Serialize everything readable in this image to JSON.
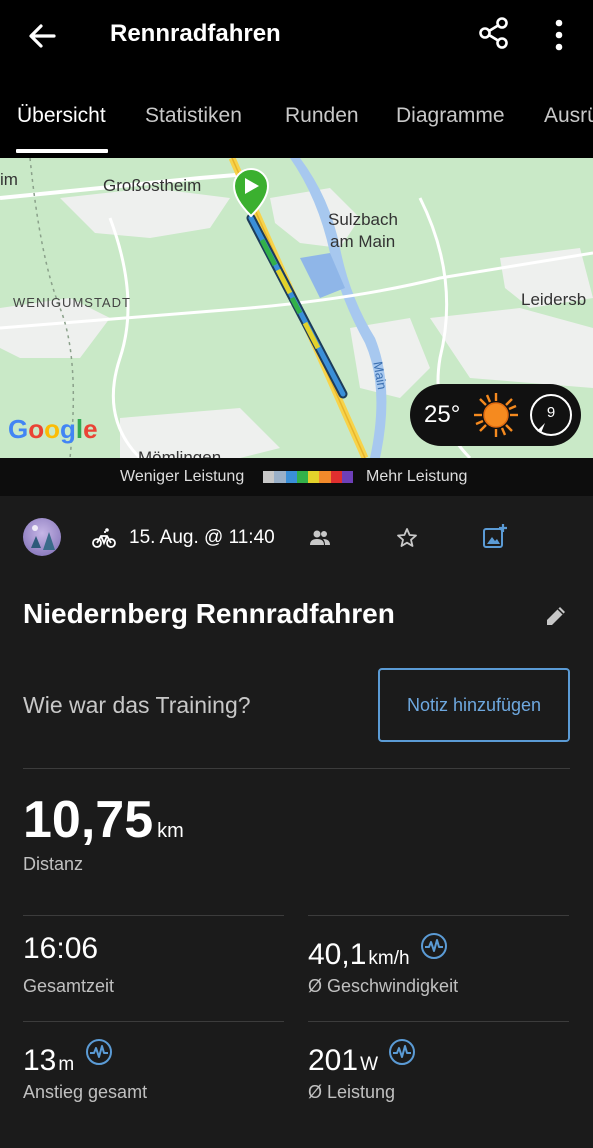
{
  "header": {
    "title": "Rennradfahren"
  },
  "tabs": [
    {
      "label": "Übersicht"
    },
    {
      "label": "Statistiken"
    },
    {
      "label": "Runden"
    },
    {
      "label": "Diagramme"
    },
    {
      "label": "Ausrü"
    }
  ],
  "map": {
    "labels": {
      "im": "im",
      "grossostheim": "Großostheim",
      "sulzbach_1": "Sulzbach",
      "sulzbach_2": "am Main",
      "wenigumstadt": "WENIGUMSTADT",
      "leidersb": "Leidersb",
      "main": "Main",
      "mömlingen": "Mömlingen"
    },
    "provider": "Google",
    "weather": {
      "temperature": "25°",
      "icon": "sun-icon",
      "wind": "9"
    }
  },
  "legend": {
    "less": "Weniger Leistung",
    "more": "Mehr Leistung",
    "colors": [
      "#c8c8c8",
      "#9ab0c8",
      "#3a8fd8",
      "#33b14a",
      "#e3d22b",
      "#f28a2b",
      "#e02f2f",
      "#6d3fb8"
    ]
  },
  "activity": {
    "date": "15. Aug. @ 11:40",
    "title": "Niedernberg Rennradfahren",
    "question": "Wie war das Training?",
    "note_button": "Notiz hinzufügen"
  },
  "stats": {
    "distance": {
      "value": "10,75",
      "unit": "km",
      "label": "Distanz"
    },
    "total_time": {
      "value": "16:06",
      "unit": "",
      "label": "Gesamtzeit"
    },
    "avg_speed": {
      "value": "40,1",
      "unit": "km/h",
      "label": "Ø Geschwindigkeit"
    },
    "ascent": {
      "value": "13",
      "unit": "m",
      "label": "Anstieg gesamt"
    },
    "avg_power": {
      "value": "201",
      "unit": "W",
      "label": "Ø Leistung"
    }
  },
  "colors": {
    "accent": "#5b9bd5",
    "background": "#1b1b1b",
    "appbar": "#000000"
  }
}
